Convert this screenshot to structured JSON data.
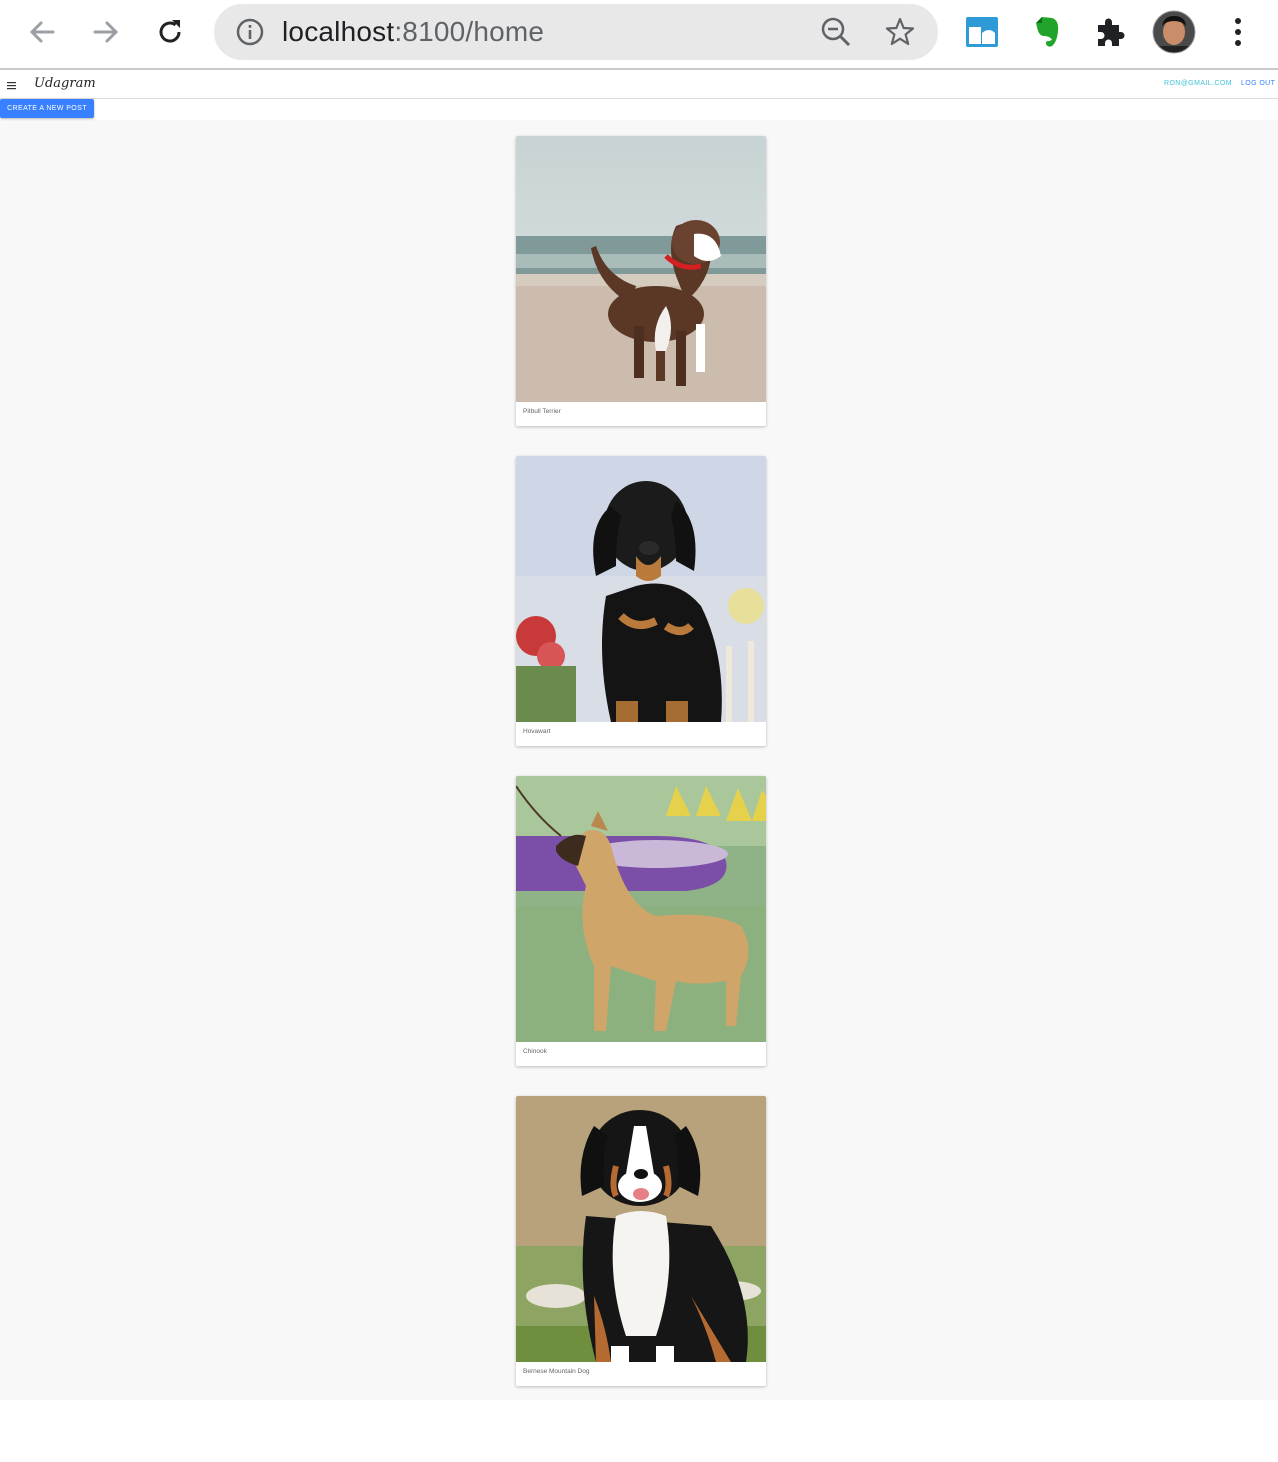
{
  "browser": {
    "url_host": "localhost",
    "url_path": ":8100/home",
    "icons": [
      "back-arrow-icon",
      "forward-arrow-icon",
      "reload-icon",
      "site-info-icon",
      "zoom-out-icon",
      "bookmark-star-icon",
      "extension-tab-icon",
      "evernote-icon",
      "puzzle-extensions-icon",
      "profile-avatar",
      "kebab-menu-icon"
    ]
  },
  "toolbar": {
    "title": "Udagram",
    "user_email": "RON@GMAIL.COM",
    "logout_label": "LOG OUT"
  },
  "actions": {
    "create_post_label": "CREATE A NEW POST"
  },
  "feed": {
    "posts": [
      {
        "caption": "Pitbull Terrier"
      },
      {
        "caption": "Hovawart"
      },
      {
        "caption": "Chinook"
      },
      {
        "caption": "Bernese Mountain Dog"
      }
    ]
  },
  "colors": {
    "accent": "#3880ff",
    "user_link": "#40c4d8",
    "content_bg": "#f8f8f8"
  }
}
